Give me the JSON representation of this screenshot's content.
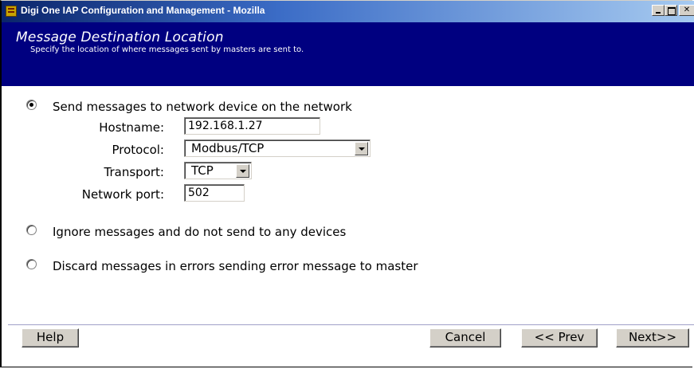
{
  "window": {
    "title": "Digi One IAP Configuration and Management - Mozilla",
    "icon": "digi-app-icon"
  },
  "header": {
    "title": "Message Destination Location",
    "subtitle": "Specify the location of where messages sent by masters are sent to."
  },
  "options": {
    "network": {
      "label": "Send messages to network device on the network",
      "checked": true
    },
    "ignore": {
      "label": "Ignore messages and do not send to any devices",
      "checked": false
    },
    "discard": {
      "label": "Discard messages in errors sending error message to master",
      "checked": false
    }
  },
  "fields": {
    "hostname": {
      "label": "Hostname:",
      "value": "192.168.1.27"
    },
    "protocol": {
      "label": "Protocol:",
      "value": "Modbus/TCP"
    },
    "transport": {
      "label": "Transport:",
      "value": "TCP"
    },
    "port": {
      "label": "Network port:",
      "value": "502"
    }
  },
  "buttons": {
    "help": "Help",
    "cancel": "Cancel",
    "prev": "<< Prev",
    "next": "Next>>"
  },
  "colors": {
    "header_bg": "#000080",
    "title_bar": "#0a246a",
    "button_face": "#d4d0c8"
  }
}
